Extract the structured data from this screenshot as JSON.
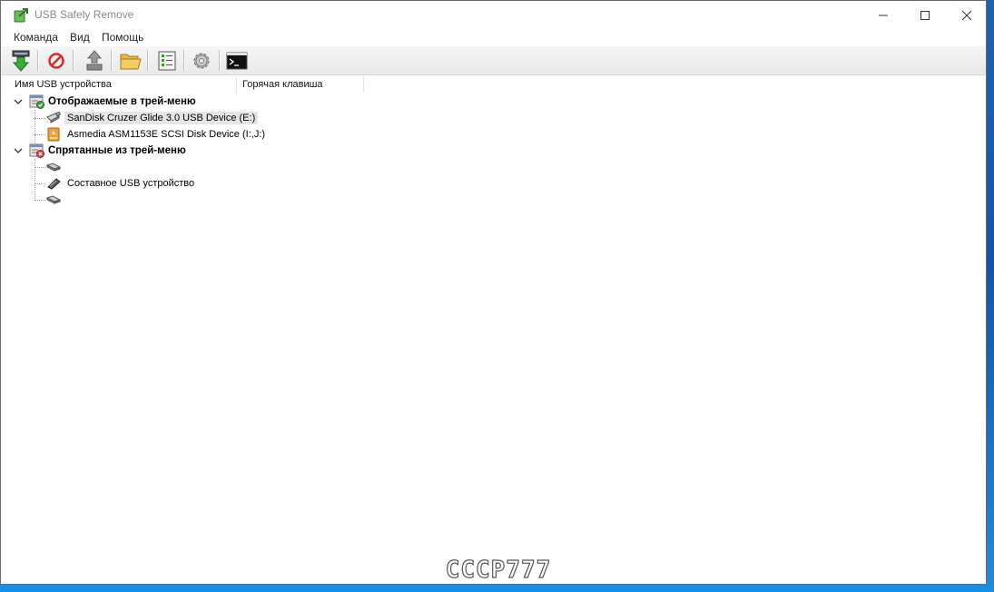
{
  "window": {
    "title": "USB Safely Remove",
    "accent": "#3aa63a"
  },
  "menu": {
    "items": [
      "Команда",
      "Вид",
      "Помощь"
    ]
  },
  "toolbar": {
    "buttons": [
      {
        "icon": "safely-remove-arrow-icon"
      },
      {
        "icon": "stop-icon"
      },
      {
        "icon": "return-device-icon"
      },
      {
        "icon": "open-folder-icon"
      },
      {
        "icon": "device-list-icon"
      },
      {
        "icon": "settings-gear-icon"
      },
      {
        "icon": "command-line-icon"
      }
    ]
  },
  "columns": {
    "name": "Имя USB устройства",
    "hotkey": "Горячая клавиша"
  },
  "tree": {
    "groups": [
      {
        "label": "Отображаемые в трей-меню",
        "icon": "tray-shown-group-icon",
        "items": [
          {
            "label": "SanDisk Cruzer Glide 3.0 USB Device (E:)",
            "icon": "usb-flash-drive-icon"
          },
          {
            "label": "Asmedia ASM1153E SCSI Disk Device (I:,J:)",
            "icon": "external-disk-icon"
          }
        ]
      },
      {
        "label": "Спрятанные из трей-меню",
        "icon": "tray-hidden-group-icon",
        "items": [
          {
            "label": "",
            "icon": "usb-plug-icon"
          },
          {
            "label": "Составное USB устройство",
            "icon": "usb-composite-icon"
          },
          {
            "label": "",
            "icon": "usb-plug-icon"
          }
        ]
      }
    ]
  },
  "watermark": "СССР777"
}
